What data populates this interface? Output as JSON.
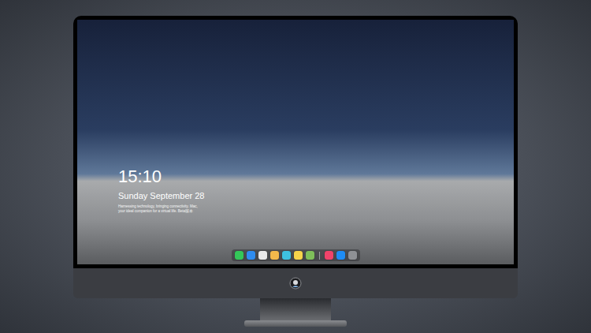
{
  "lock_screen": {
    "time": "15:10",
    "date": "Sunday September 28",
    "caption": "Harnessing technology, bringing connectivity. Mac, your ideal companion for a virtual life. Beta版本"
  },
  "dock": {
    "items": [
      {
        "kind": "app",
        "color": "#34c759"
      },
      {
        "kind": "app",
        "color": "#2f8cf0"
      },
      {
        "kind": "app",
        "color": "#e8e8ea"
      },
      {
        "kind": "app",
        "color": "#f2b84b"
      },
      {
        "kind": "app",
        "color": "#3ec1e0"
      },
      {
        "kind": "app",
        "color": "#f7d44a"
      },
      {
        "kind": "app",
        "color": "#7fbf5a"
      },
      {
        "kind": "separator",
        "color": "#9a9ca0"
      },
      {
        "kind": "app",
        "color": "#f0436a"
      },
      {
        "kind": "app",
        "color": "#1e8cf5"
      },
      {
        "kind": "app",
        "color": "#8e9095"
      }
    ]
  }
}
